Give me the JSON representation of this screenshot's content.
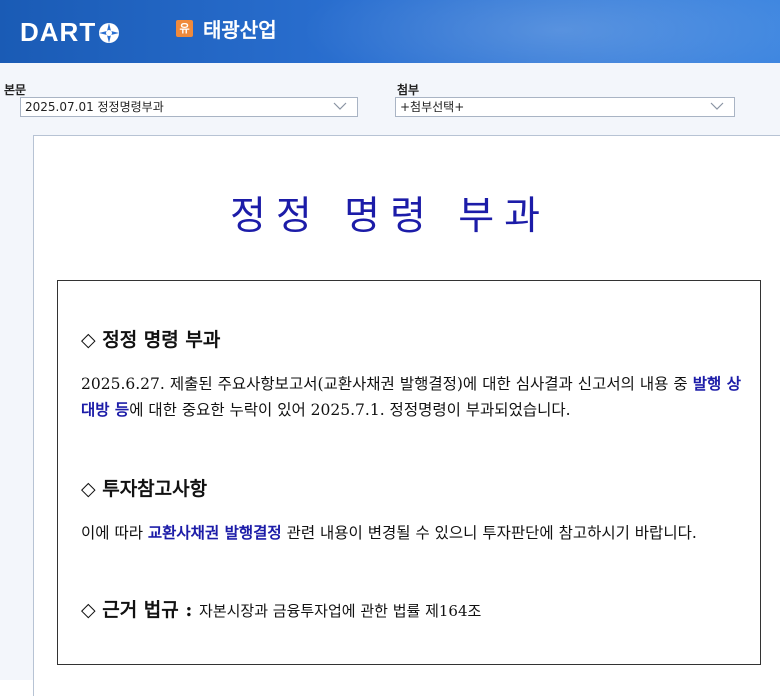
{
  "header": {
    "logo_text": "DART",
    "company_badge": "유",
    "company_name": "태광산업"
  },
  "selectors": {
    "main": {
      "label": "본문",
      "value": "2025.07.01  정정명령부과"
    },
    "attachment": {
      "label": "첨부",
      "value": "+첨부선택+"
    }
  },
  "document": {
    "title": "정정 명령 부과",
    "section1": {
      "heading": "◇ 정정 명령 부과",
      "text_before": "2025.6.27. 제출된 주요사항보고서(교환사채권 발행결정)에 대한 심사결과 신고서의 내용 중 ",
      "highlight": "발행 상대방 등",
      "text_after": "에 대한 중요한 누락이 있어 2025.7.1. 정정명령이 부과되었습니다."
    },
    "section2": {
      "heading": "◇ 투자참고사항",
      "text_before": "이에 따라 ",
      "highlight": "교환사채권 발행결정",
      "text_after": " 관련 내용이 변경될 수 있으니 투자판단에 참고하시기 바랍니다."
    },
    "section3": {
      "heading": "◇ 근거 법규 : ",
      "text": "자본시장과 금융투자업에 관한 법률 제164조"
    }
  },
  "colors": {
    "header_blue": "#2a6fd0",
    "title_blue": "#1c1ca8",
    "badge_orange": "#f08a3c"
  }
}
